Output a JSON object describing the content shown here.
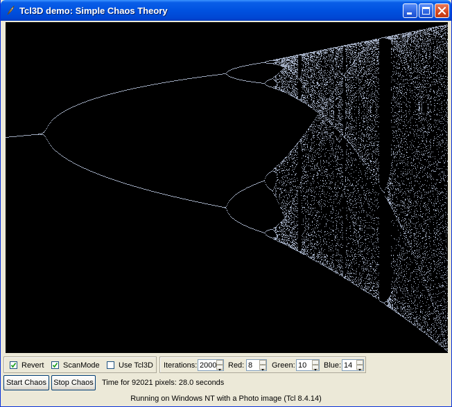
{
  "window": {
    "title": "Tcl3D demo: Simple Chaos Theory",
    "icon": "feather-icon",
    "buttons": [
      "minimize-icon",
      "maximize-icon",
      "close-icon"
    ]
  },
  "canvas": {
    "description_icon": "bifurcation-diagram",
    "background": "#000000",
    "foreground": "#ffffff"
  },
  "options": {
    "revert": {
      "label": "Revert",
      "checked": true
    },
    "scanmode": {
      "label": "ScanMode",
      "checked": true
    },
    "use_tcl3d": {
      "label": "Use Tcl3D",
      "checked": false
    }
  },
  "settings": {
    "iterations": {
      "label": "Iterations:",
      "value": "2000"
    },
    "red": {
      "label": "Red:",
      "value": "8"
    },
    "green": {
      "label": "Green:",
      "value": "10"
    },
    "blue": {
      "label": "Blue:",
      "value": "14"
    }
  },
  "actions": {
    "start": "Start Chaos",
    "stop": "Stop Chaos"
  },
  "status": {
    "time": "Time for 92021 pixels: 28.0 seconds",
    "info": "Running on Windows NT with a Photo image (Tcl 8.4.14)"
  }
}
